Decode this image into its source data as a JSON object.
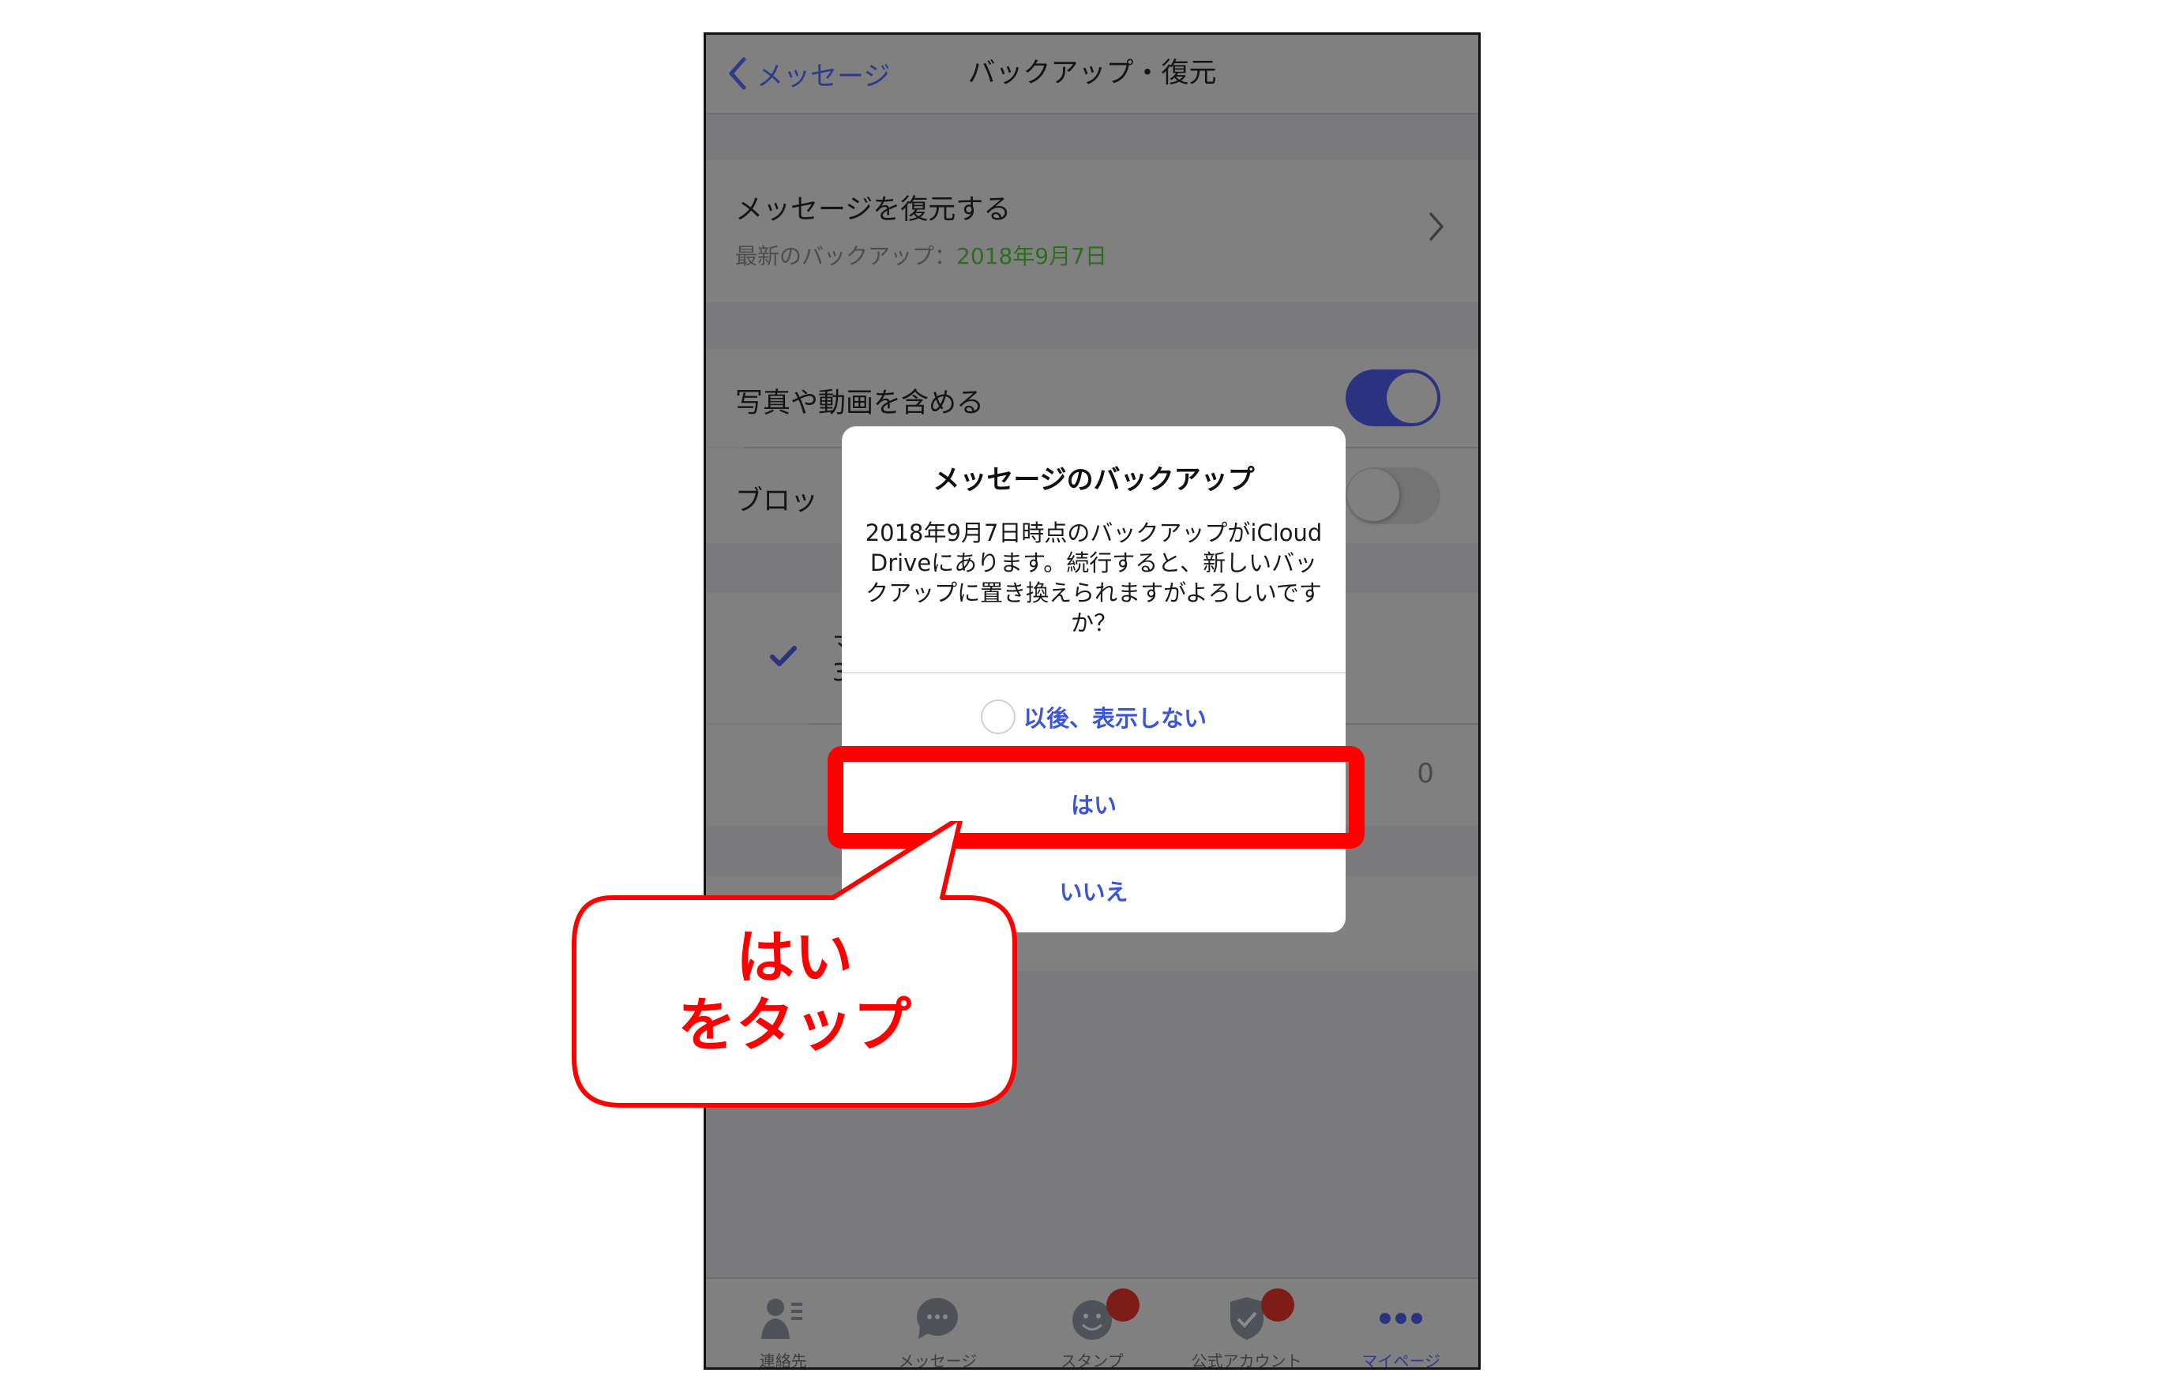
{
  "nav": {
    "back_label": "メッセージ",
    "title": "バックアップ・復元"
  },
  "restore_row": {
    "title": "メッセージを復元する",
    "sub_label": "最新のバックアップ：",
    "sub_date": "2018年9月7日"
  },
  "settings": {
    "include_media_label": "写真や動画を含める",
    "include_media_on": true,
    "block_label_partial": "ブロッ",
    "block_on": false
  },
  "hidden_rows": {
    "checked_row_partial_1": "マ",
    "checked_row_partial_2": "3",
    "count_value": "0"
  },
  "dialog": {
    "title": "メッセージのバックアップ",
    "message": "2018年9月7日時点のバックアップがiCloud Driveにあります。続行すると、新しいバックアップに置き換えられますがよろしいですか？",
    "dont_show_label": "以後、表示しない",
    "dont_show_checked": false,
    "yes_label": "はい",
    "no_label": "いいえ"
  },
  "callout": {
    "line1": "はい",
    "line2": "をタップ"
  },
  "tabbar": {
    "items": [
      {
        "label": "連絡先",
        "icon": "contacts-icon",
        "badge": false,
        "active": false
      },
      {
        "label": "メッセージ",
        "icon": "chat-bubble-icon",
        "badge": false,
        "active": false
      },
      {
        "label": "スタンプ",
        "icon": "smiley-icon",
        "badge": true,
        "active": false
      },
      {
        "label": "公式アカウント",
        "icon": "shield-check-icon",
        "badge": true,
        "active": false
      },
      {
        "label": "マイページ",
        "icon": "more-dots-icon",
        "badge": false,
        "active": true
      }
    ]
  },
  "colors": {
    "accent": "#3b55d9",
    "annotation_red": "#ff0000",
    "date_green": "#2b6e20",
    "toggle_on": "#2b3380",
    "badge": "#7e1c18"
  }
}
